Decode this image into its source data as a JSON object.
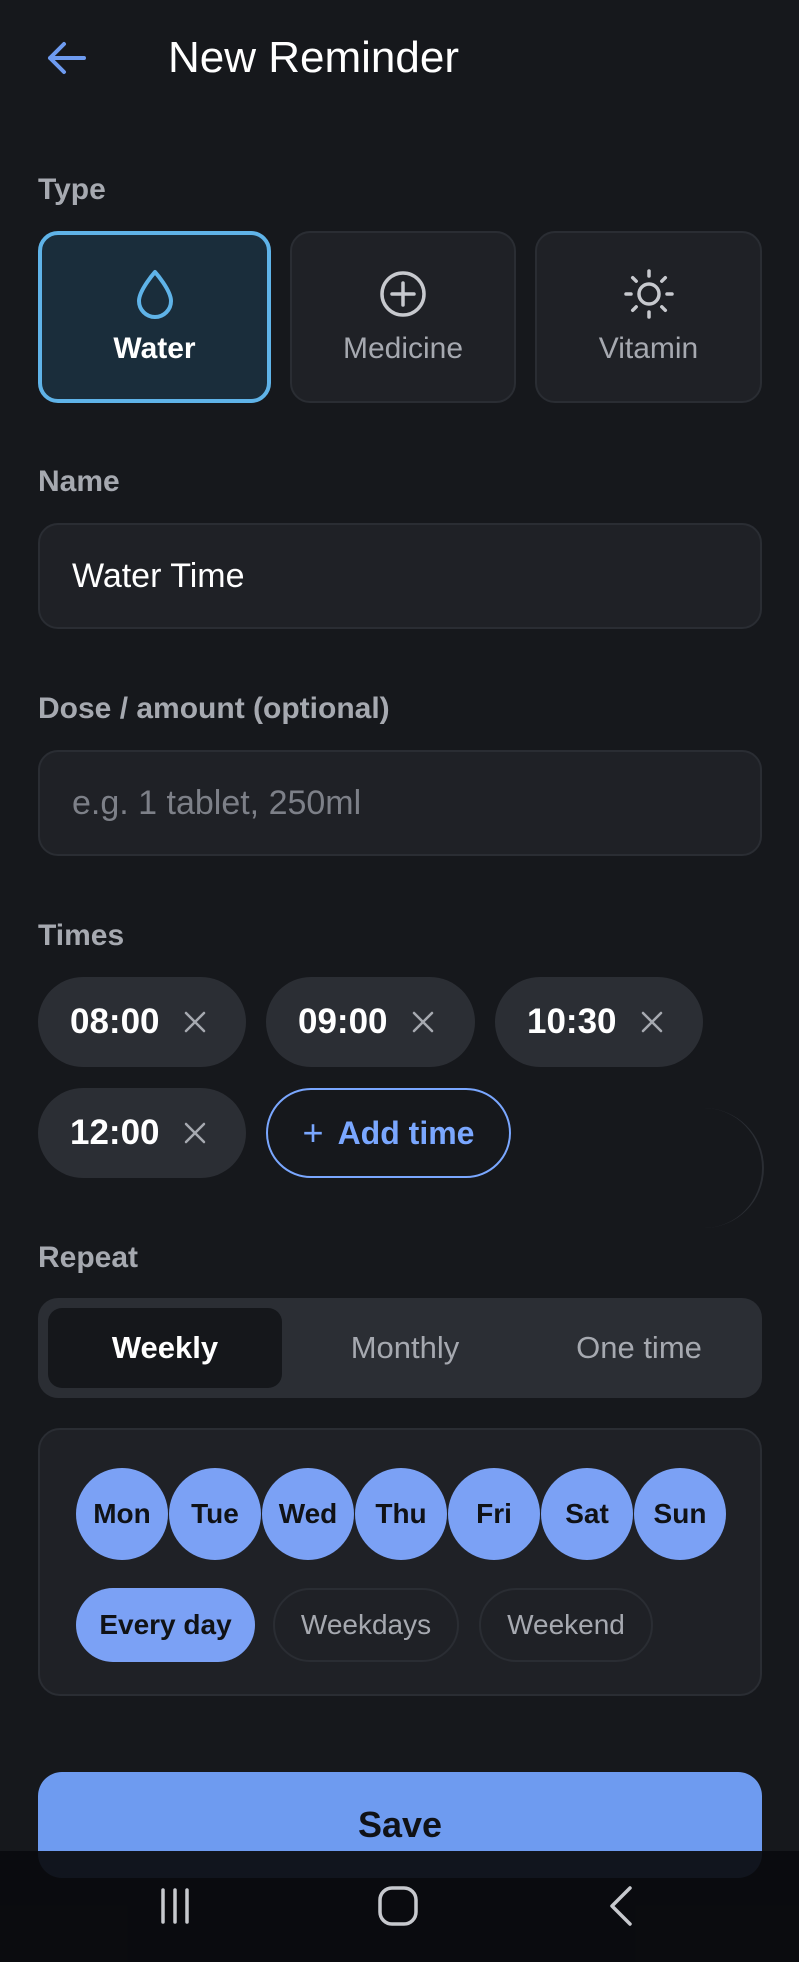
{
  "header": {
    "title": "New Reminder",
    "back_icon": "arrow-left-icon"
  },
  "type_section": {
    "label": "Type",
    "options": [
      {
        "label": "Water",
        "icon": "water-drop-icon",
        "selected": true
      },
      {
        "label": "Medicine",
        "icon": "plus-circle-icon",
        "selected": false
      },
      {
        "label": "Vitamin",
        "icon": "sun-icon",
        "selected": false
      }
    ]
  },
  "name_section": {
    "label": "Name",
    "value": "Water Time"
  },
  "dose_section": {
    "label": "Dose / amount (optional)",
    "placeholder": "e.g. 1 tablet, 250ml"
  },
  "times_section": {
    "label": "Times",
    "times": [
      "08:00",
      "09:00",
      "10:30",
      "12:00"
    ],
    "add_label": "Add time"
  },
  "repeat_section": {
    "label": "Repeat",
    "modes": [
      "Weekly",
      "Monthly",
      "One time"
    ],
    "active_mode": "Weekly",
    "days": [
      "Mon",
      "Tue",
      "Wed",
      "Thu",
      "Fri",
      "Sat",
      "Sun"
    ],
    "presets": [
      "Every day",
      "Weekdays",
      "Weekend"
    ],
    "active_preset": "Every day"
  },
  "save_label": "Save",
  "colors": {
    "accent": "#7ba1f5",
    "selected_border": "#5fb3e8",
    "background": "#16181c"
  }
}
